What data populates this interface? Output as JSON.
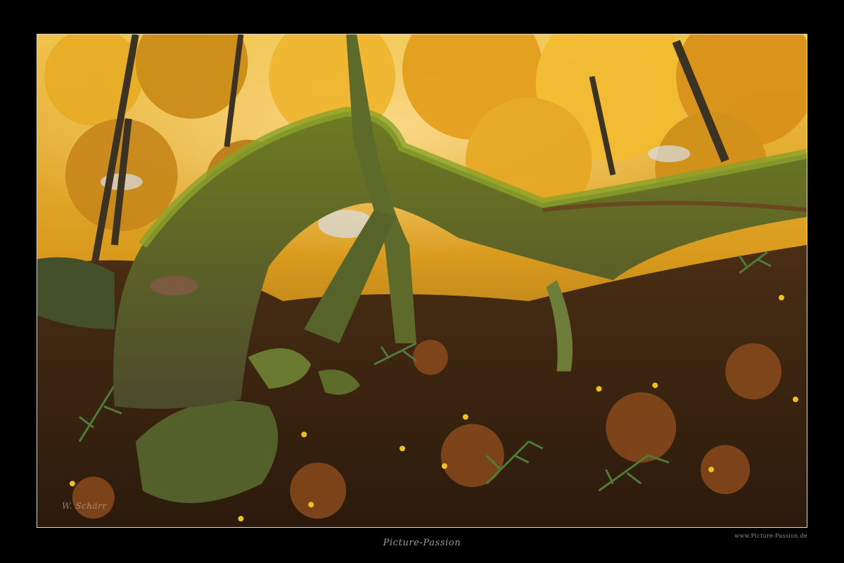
{
  "photo": {
    "subject": "mossy-fallen-tree-autumn-forest",
    "signature": "W. Schärr"
  },
  "caption": {
    "title": "Picture-Passion",
    "url": "www.Picture-Passion.de"
  },
  "colors": {
    "background": "#000000",
    "frame_border": "#d9d9d9",
    "foliage": "#e0a21a",
    "moss": "#6f7f1e",
    "forest_floor": "#5a3417"
  }
}
